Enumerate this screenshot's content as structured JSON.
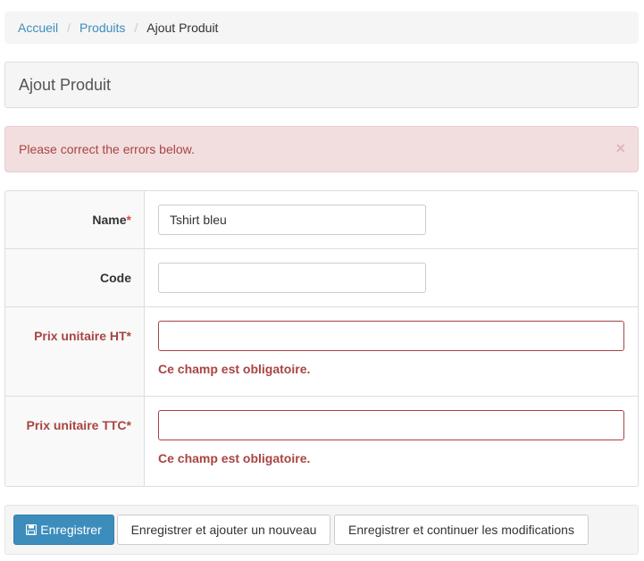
{
  "breadcrumb": {
    "items": [
      "Accueil",
      "Produits"
    ],
    "separator": "/",
    "active": "Ajout Produit"
  },
  "page": {
    "title": "Ajout Produit"
  },
  "alert": {
    "message": "Please correct the errors below.",
    "close": "×"
  },
  "form": {
    "required_mark": "*",
    "fields": [
      {
        "label": "Name",
        "required": true,
        "value": "Tshirt bleu",
        "error": ""
      },
      {
        "label": "Code",
        "required": false,
        "value": "",
        "error": ""
      },
      {
        "label": "Prix unitaire HT",
        "required": true,
        "value": "",
        "error": "Ce champ est obligatoire."
      },
      {
        "label": "Prix unitaire TTC",
        "required": true,
        "value": "",
        "error": "Ce champ est obligatoire."
      }
    ]
  },
  "actions": {
    "save": "Enregistrer",
    "save_add": "Enregistrer et ajouter un nouveau",
    "save_continue": "Enregistrer et continuer les modifications",
    "save_icon": "floppy-disk-icon"
  },
  "colors": {
    "primary": "#3c8dbc",
    "error": "#a94442",
    "required": "#dd4b39"
  }
}
